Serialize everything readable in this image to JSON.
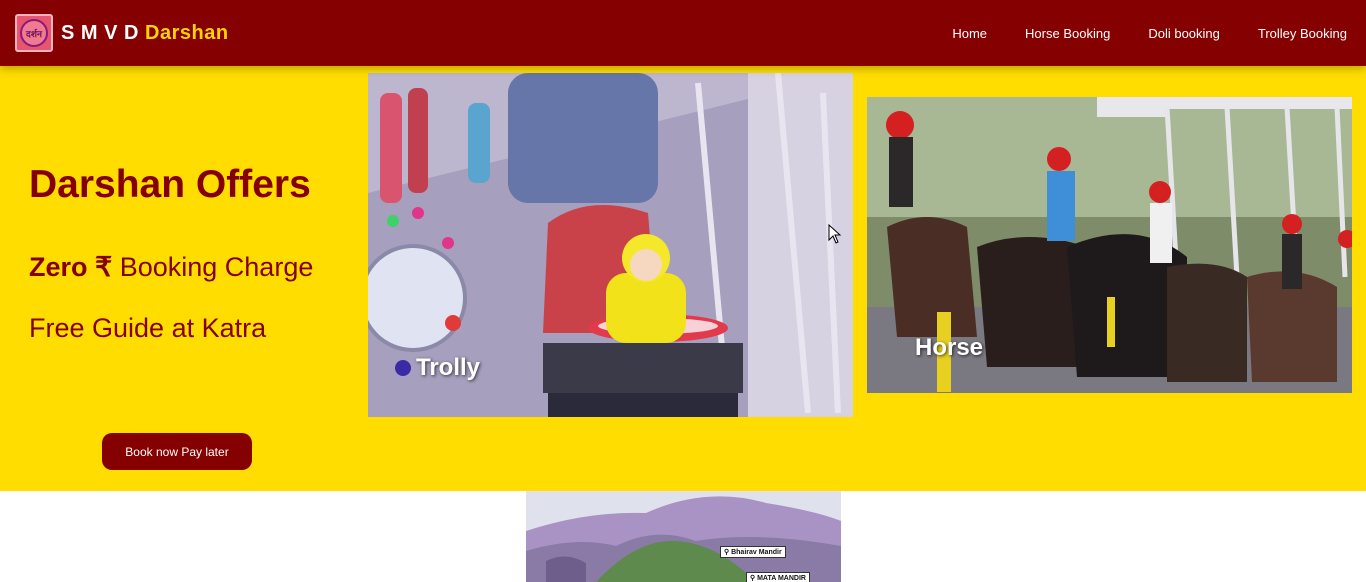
{
  "brand": {
    "logo_text": "दर्शन",
    "name_prefix": "S M V D",
    "name_accent": "Darshan"
  },
  "nav": {
    "items": [
      {
        "label": "Home"
      },
      {
        "label": "Horse Booking"
      },
      {
        "label": "Doli booking"
      },
      {
        "label": "Trolley Booking"
      }
    ]
  },
  "hero": {
    "title": "Darshan Offers",
    "offer1_bold": "Zero ₹",
    "offer1_rest": "Booking Charge",
    "offer2": "Free Guide at Katra",
    "button_label": "Book now Pay later"
  },
  "photos": {
    "trolly_caption": "Trolly",
    "horse_caption": "Horse"
  },
  "map": {
    "tag1": "Bhairav Mandir",
    "tag2": "MATA MANDIR"
  },
  "colors": {
    "maroon": "#850000",
    "yellow": "#ffdd00",
    "brand_accent": "#ffd400"
  },
  "icons": {
    "logo": "darshan-logo-icon",
    "pin": "map-pin-icon",
    "cursor": "mouse-cursor-icon"
  }
}
